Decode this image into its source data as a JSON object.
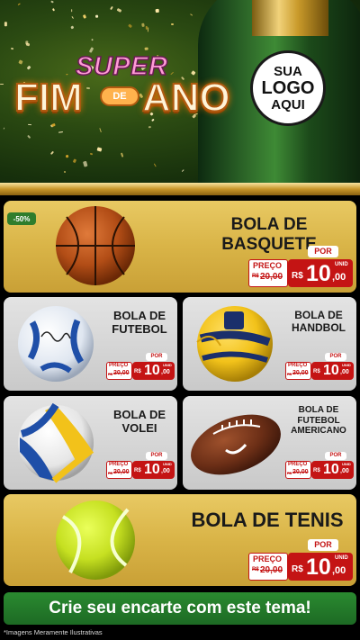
{
  "header": {
    "title_super": "SUPER",
    "title_fim": "FIM",
    "title_de": "DE",
    "title_ano": "ANO",
    "logo_line1": "SUA",
    "logo_line2": "LOGO",
    "logo_line3": "AQUI"
  },
  "badge_discount": "-50%",
  "products": [
    {
      "name": "BOLA DE BASQUETE",
      "por": "POR",
      "preco_label": "PREÇO",
      "old_prefix": "R$",
      "old_price": "20,00",
      "new_prefix": "R$",
      "new_int": "10",
      "new_dec": ",00",
      "unid": "UNID"
    },
    {
      "name_l1": "BOLA DE",
      "name_l2": "FUTEBOL",
      "por": "POR",
      "preco_label": "PREÇO",
      "old_prefix": "R$",
      "old_price": "20,00",
      "new_prefix": "R$",
      "new_int": "10",
      "new_dec": ",00",
      "unid": "UNID"
    },
    {
      "name_l1": "BOLA DE",
      "name_l2": "HANDBOL",
      "por": "POR",
      "preco_label": "PREÇO",
      "old_prefix": "R$",
      "old_price": "20,00",
      "new_prefix": "R$",
      "new_int": "10",
      "new_dec": ",00",
      "unid": "UNID"
    },
    {
      "name_l1": "BOLA DE",
      "name_l2": "VOLEI",
      "por": "POR",
      "preco_label": "PREÇO",
      "old_prefix": "R$",
      "old_price": "20,00",
      "new_prefix": "R$",
      "new_int": "10",
      "new_dec": ",00",
      "unid": "UNID"
    },
    {
      "name_l1": "BOLA DE",
      "name_l2": "FUTEBOL",
      "name_l3": "AMERICANO",
      "por": "POR",
      "preco_label": "PREÇO",
      "old_prefix": "R$",
      "old_price": "20,00",
      "new_prefix": "R$",
      "new_int": "10",
      "new_dec": ",00",
      "unid": "UNID"
    },
    {
      "name": "BOLA DE TENIS",
      "por": "POR",
      "preco_label": "PREÇO",
      "old_prefix": "R$",
      "old_price": "20,00",
      "new_prefix": "R$",
      "new_int": "10",
      "new_dec": ",00",
      "unid": "UNID"
    }
  ],
  "cta": "Crie seu encarte com este tema!",
  "footnote": "*Imagens Meramente Ilustrativas",
  "colors": {
    "gold": "#d9b447",
    "red": "#c41414",
    "green": "#2a8a30"
  },
  "icons": [
    "basketball-icon",
    "soccer-ball-icon",
    "handball-icon",
    "volleyball-icon",
    "american-football-icon",
    "tennis-ball-icon",
    "champagne-bottle-icon"
  ]
}
